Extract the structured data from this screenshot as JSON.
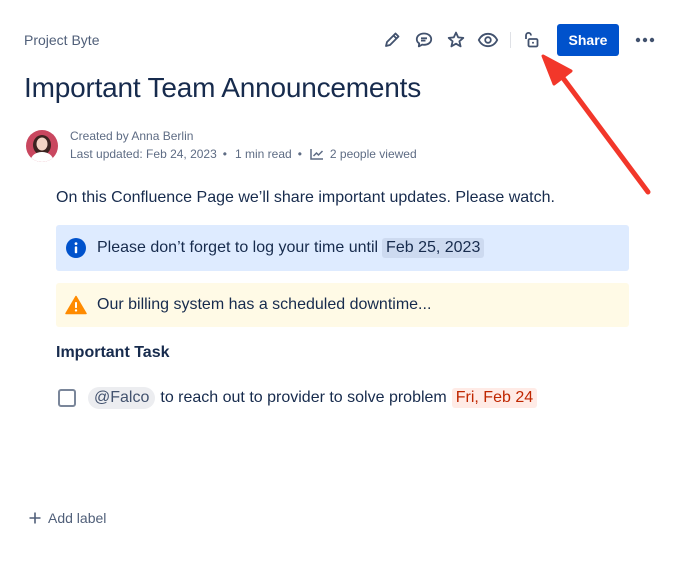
{
  "header": {
    "space_name": "Project Byte",
    "toolbar_icons": [
      "edit-icon",
      "comment-icon",
      "star-icon",
      "watch-icon",
      "restrictions-icon"
    ],
    "share_label": "Share",
    "more_icon": "more-icon"
  },
  "page": {
    "title": "Important Team Announcements",
    "byline": {
      "created_by": "Created by Anna Berlin",
      "last_updated": "Last updated: Feb 24, 2023",
      "read_time": "1 min read",
      "views": "2 people viewed"
    },
    "intro": "On this Confluence Page we’ll share important updates. Please watch.",
    "info_panel": {
      "text": "Please don’t forget to log your time until",
      "date": "Feb 25, 2023"
    },
    "note_panel": {
      "text": "Our billing system has a scheduled downtime..."
    },
    "task_heading": "Important Task",
    "task": {
      "mention": "@Falco",
      "text": "to reach out to provider to solve problem",
      "due": "Fri, Feb 24",
      "checked": false
    }
  },
  "footer": {
    "add_label": "Add label"
  },
  "colors": {
    "primary": "#0052cc",
    "info_bg": "#deebff",
    "note_bg": "#fffae6",
    "annotation_arrow": "#f2372a"
  }
}
